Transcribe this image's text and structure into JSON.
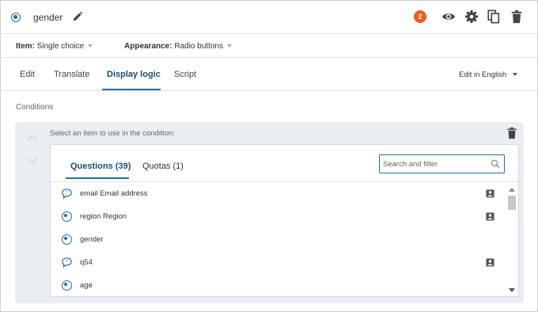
{
  "header": {
    "question_name": "gender",
    "badge_count": "2",
    "icons": [
      "radio-question-icon",
      "pencil-icon",
      "eye-icon",
      "gear-icon",
      "copy-icon",
      "trash-icon"
    ]
  },
  "properties": {
    "item_label": "Item:",
    "item_value": "Single choice",
    "appearance_label": "Appearance:",
    "appearance_value": "Radio buttons"
  },
  "tabs": {
    "edit": "Edit",
    "translate": "Translate",
    "display_logic": "Display logic",
    "script": "Script",
    "active": "Display logic",
    "edit_language": "Edit in English"
  },
  "conditions": {
    "label": "Conditions",
    "select_hint": "Select an item to use in the condition:",
    "picker": {
      "tab_questions": "Questions (39)",
      "tab_quotas": "Quotas (1)",
      "active_tab": "Questions (39)",
      "search_placeholder": "Search and filter",
      "items": [
        {
          "label": "email Email address",
          "icon": "open-text-icon",
          "pii": true
        },
        {
          "label": "region Region",
          "icon": "radio-icon",
          "pii": true
        },
        {
          "label": "gender",
          "icon": "radio-icon",
          "pii": false
        },
        {
          "label": "q54",
          "icon": "open-text-icon",
          "pii": true
        },
        {
          "label": "age",
          "icon": "radio-icon",
          "pii": false
        }
      ]
    }
  },
  "colors": {
    "accent": "#1a73a8",
    "badge": "#f15a22",
    "panel_bg": "#eaeef2",
    "active_text": "#1a4e74"
  }
}
